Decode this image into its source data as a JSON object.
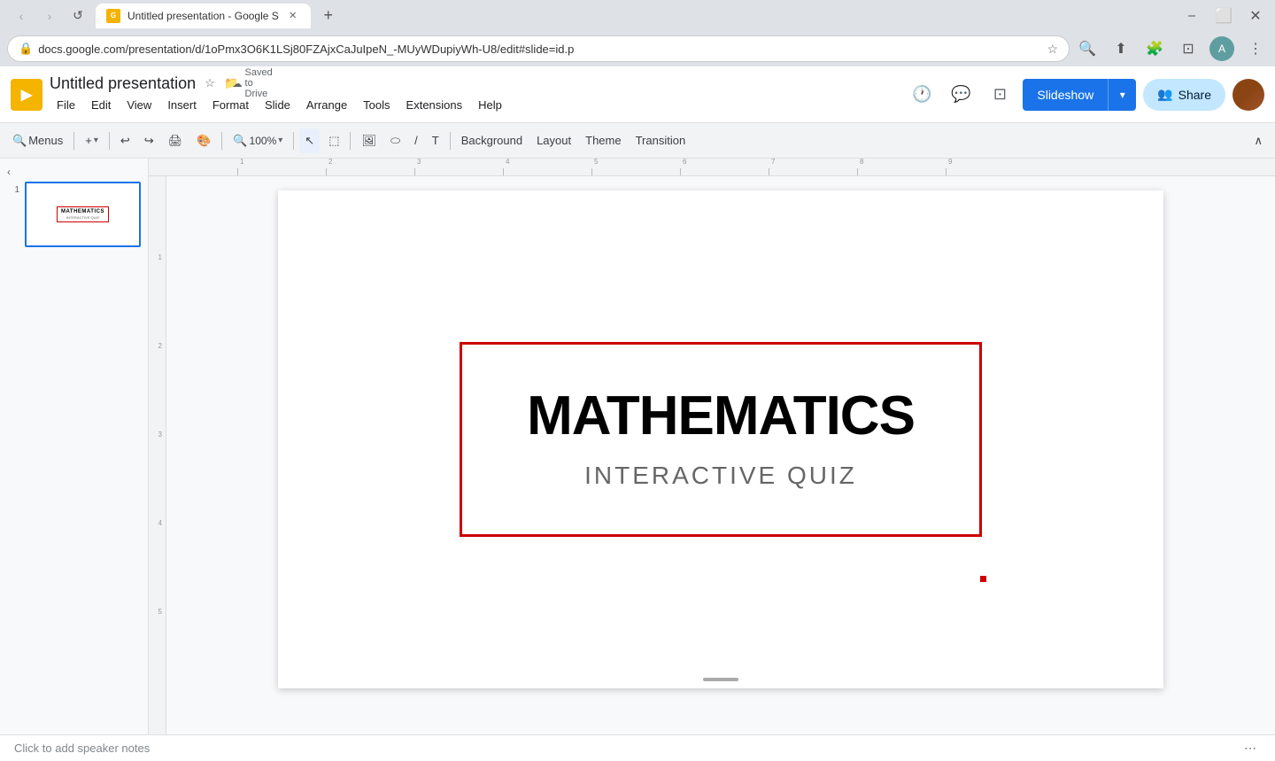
{
  "browser": {
    "tab_title": "Untitled presentation - Google S",
    "tab_favicon": "G",
    "new_tab_btn": "+",
    "url": "docs.google.com/presentation/d/1oPmx3O6K1LSj80FZAjxCaJuIpeN_-MUyWDupiyWh-U8/edit#slide=id.p",
    "nav_back": "‹",
    "nav_forward": "›",
    "nav_refresh": "↺",
    "search_icon": "🔍",
    "bookmark_icon": "☆",
    "extension_icon": "🧩",
    "account_icon": "👤",
    "menu_icon": "⋮",
    "cast_icon": "⊡",
    "profile_icon": "👤"
  },
  "app": {
    "logo": "G",
    "title": "Untitled presentation",
    "star_icon": "☆",
    "folder_icon": "📁",
    "saved_to_drive": "Saved to Drive",
    "cloud_icon": "☁",
    "menu_items": [
      "File",
      "Edit",
      "View",
      "Insert",
      "Format",
      "Slide",
      "Arrange",
      "Tools",
      "Extensions",
      "Help"
    ],
    "header_icons": {
      "history": "🕐",
      "comment": "💬",
      "present_mode": "⊡"
    },
    "slideshow_btn": "Slideshow",
    "slideshow_dropdown": "▾",
    "share_icon": "👥",
    "share_btn": "Share"
  },
  "toolbar": {
    "menus": "Menus",
    "zoom_in": "+",
    "undo": "↩",
    "redo": "↪",
    "print": "🖨",
    "paint_format": "🎨",
    "zoom": "100%",
    "zoom_dropdown": "▾",
    "select_tool": "↖",
    "frame_select": "⬚",
    "image_insert": "🖼",
    "shape_insert": "⬭",
    "line_tool": "/",
    "text_box": "T",
    "background_btn": "Background",
    "layout_btn": "Layout",
    "theme_btn": "Theme",
    "transition_btn": "Transition",
    "collapse_icon": "∧"
  },
  "slides": [
    {
      "number": "1",
      "title": "MATHEMATICS",
      "subtitle": "INTERACTIVE QUIZ"
    }
  ],
  "slide_content": {
    "main_title": "MATHEMATICS",
    "subtitle": "INTERACTIVE QUIZ"
  },
  "notes": {
    "placeholder": "Click to add speaker notes"
  },
  "ruler": {
    "h_marks": [
      "",
      "1",
      "2",
      "3",
      "4",
      "5",
      "6",
      "7",
      "8",
      "9"
    ],
    "v_marks": [
      "",
      "1",
      "2",
      "3",
      "4",
      "5"
    ]
  }
}
